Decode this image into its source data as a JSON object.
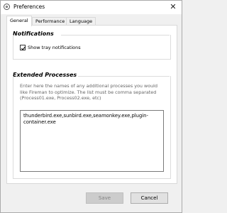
{
  "window": {
    "title": "Preferences",
    "close_glyph": "✕"
  },
  "tabs": [
    {
      "label": "General",
      "active": true
    },
    {
      "label": "Performance",
      "active": false
    },
    {
      "label": "Language",
      "active": false
    }
  ],
  "notifications": {
    "heading": "Notifications",
    "show_tray": {
      "label": "Show tray notifications",
      "checked": true
    }
  },
  "extended_processes": {
    "heading": "Extended Processes",
    "description": "Enter here the names of any additional processes you would like Fireman to optimize. The list must be comma separated (Process01.exe, Process02.exe, etc)",
    "value": "thunderbird.exe,sunbird.exe,seamonkey.exe,plugin-container.exe"
  },
  "buttons": {
    "save": "Save",
    "cancel": "Cancel",
    "save_enabled": false
  },
  "colors": {
    "panel": "#ffffff",
    "window": "#f0f0f0",
    "disabled_button": "#cccccc"
  },
  "icons": {
    "app": "settings-gear-icon",
    "close": "close-icon",
    "check": "checkmark-icon"
  }
}
